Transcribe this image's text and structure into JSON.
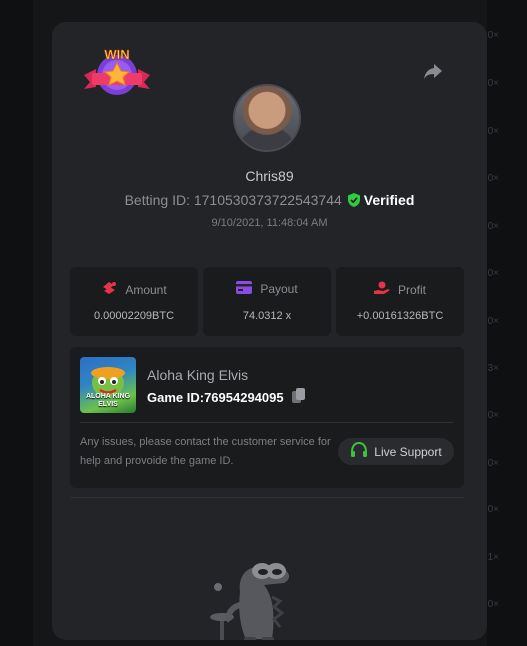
{
  "background": {
    "multipliers": [
      "0×",
      "0×",
      "0×",
      "0×",
      "0×",
      "0×",
      "0×",
      "3×",
      "0×",
      "0×",
      "0×",
      "1×",
      "0×",
      "0×"
    ]
  },
  "modal": {
    "badge_text": "WIN",
    "username": "Chris89",
    "betting_id_label": "Betting ID: 1710530373722543744",
    "verified_label": "Verified",
    "datetime": "9/10/2021, 11:48:04 AM"
  },
  "stats": [
    {
      "label": "Amount",
      "value": "0.00002209BTC",
      "icon": "coins-icon"
    },
    {
      "label": "Payout",
      "value": "74.0312 x",
      "icon": "card-icon"
    },
    {
      "label": "Profit",
      "value": "+0.00161326BTC",
      "icon": "hand-coin-icon"
    }
  ],
  "game": {
    "name": "Aloha King Elvis",
    "thumb_label": "ALOHA KING ELVIS",
    "id_label": "Game ID:76954294095",
    "contact_text": "Any issues, please contact the customer service for help and provoide the game ID.",
    "support_label": "Live Support"
  },
  "colors": {
    "accent_red": "#e3344a",
    "accent_purple": "#8a4ce6",
    "verified_green": "#2ecc40",
    "support_green": "#3fc33f"
  }
}
